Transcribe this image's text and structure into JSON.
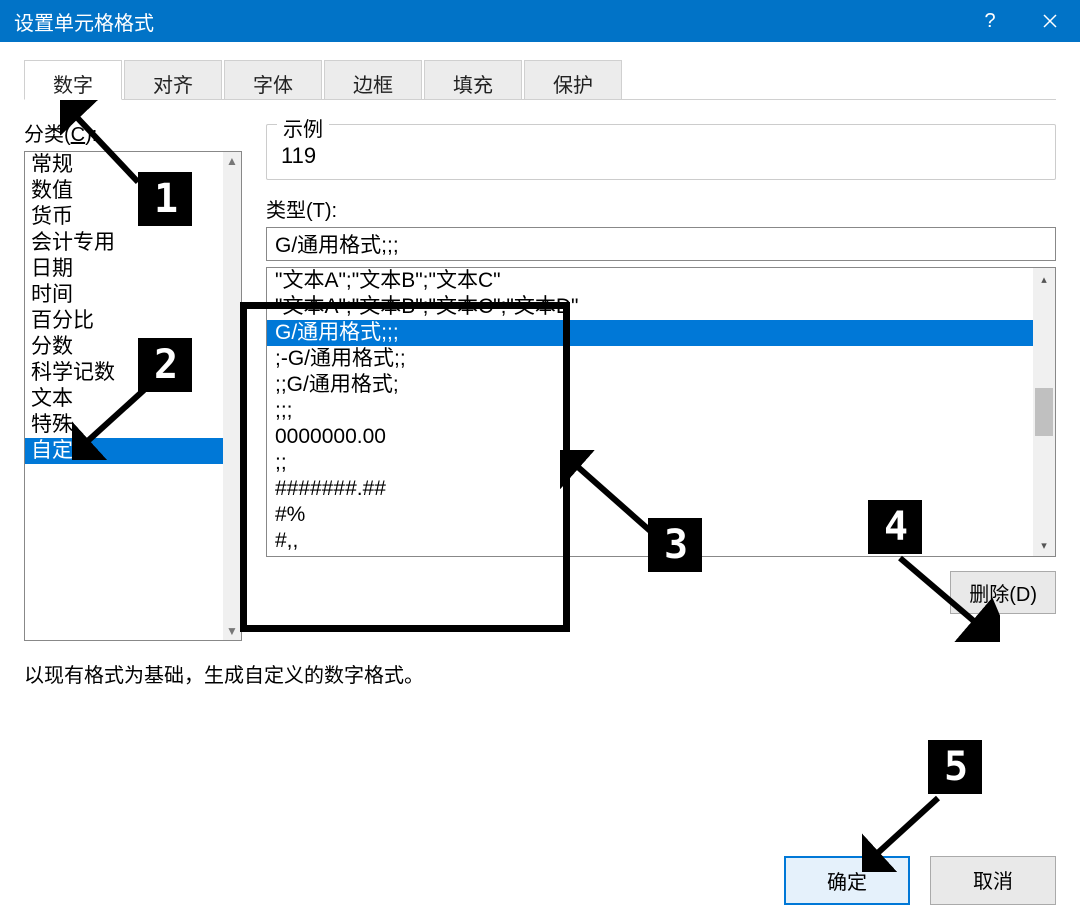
{
  "window": {
    "title": "设置单元格格式"
  },
  "tabs": [
    "数字",
    "对齐",
    "字体",
    "边框",
    "填充",
    "保护"
  ],
  "active_tab_index": 0,
  "category": {
    "label_prefix": "分类(",
    "label_key": "C",
    "label_suffix": "):",
    "items": [
      "常规",
      "数值",
      "货币",
      "会计专用",
      "日期",
      "时间",
      "百分比",
      "分数",
      "科学记数",
      "文本",
      "特殊",
      "自定义"
    ],
    "selected_index": 11
  },
  "example": {
    "label": "示例",
    "value": "119"
  },
  "type": {
    "label_prefix": "类型(",
    "label_key": "T",
    "label_suffix": "):",
    "value": "G/通用格式;;;"
  },
  "format_list": {
    "items": [
      "\"文本A\";\"文本B\";\"文本C\"",
      "\"文本A\";\"文本B\";\"文本C\";\"文本D\"",
      "G/通用格式;;;",
      ";-G/通用格式;;",
      ";;G/通用格式;",
      ";;;",
      "0000000.00",
      ";;",
      "#######.##",
      "#%",
      "#,,"
    ],
    "selected_index": 2
  },
  "buttons": {
    "delete_prefix": "删除(",
    "delete_key": "D",
    "delete_suffix": ")",
    "ok": "确定",
    "cancel": "取消"
  },
  "helper_text": "以现有格式为基础，生成自定义的数字格式。",
  "markers": [
    "1",
    "2",
    "3",
    "4",
    "5"
  ]
}
